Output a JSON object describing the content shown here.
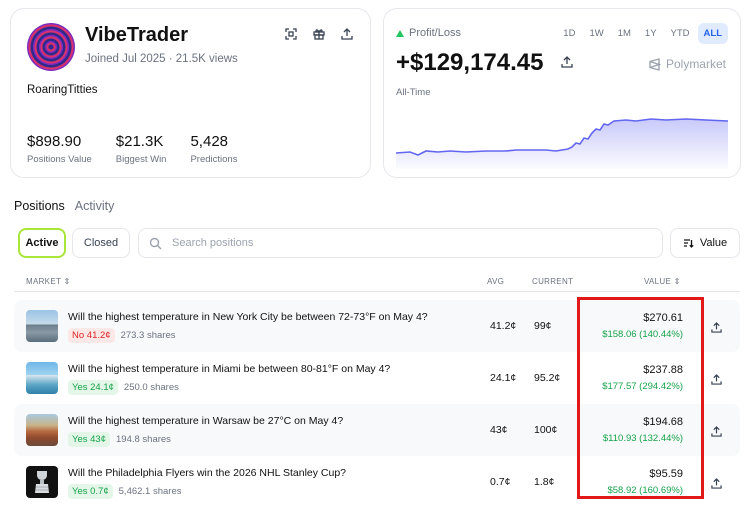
{
  "profile": {
    "username": "VibeTrader",
    "joined": "Joined Jul 2025 · 21.5K views",
    "tagline": "RoaringTitties",
    "stats": [
      {
        "value": "$898.90",
        "label": "Positions Value"
      },
      {
        "value": "$21.3K",
        "label": "Biggest Win"
      },
      {
        "value": "5,428",
        "label": "Predictions"
      }
    ]
  },
  "pnl": {
    "label": "Profit/Loss",
    "amount": "+$129,174.45",
    "range_label": "All-Time",
    "brand": "Polymarket",
    "ranges": [
      "1D",
      "1W",
      "1M",
      "1Y",
      "YTD",
      "ALL"
    ],
    "selected_range": "ALL",
    "line_color": "#6366f1"
  },
  "tabs": {
    "positions": "Positions",
    "activity": "Activity"
  },
  "filters": {
    "active": "Active",
    "closed": "Closed"
  },
  "search": {
    "placeholder": "Search positions"
  },
  "sort": {
    "label": "Value"
  },
  "table": {
    "headers": {
      "market": "MARKET",
      "avg": "AVG",
      "current": "CURRENT",
      "value": "VALUE"
    },
    "rows": [
      {
        "question": "Will the highest temperature in New York City be between 72-73°F on May 4?",
        "side": "No 41.2¢",
        "side_type": "no",
        "shares": "273.3 shares",
        "avg": "41.2¢",
        "current": "99¢",
        "value": "$270.61",
        "change": "$158.06 (140.44%)",
        "thumb": "nyc-skyline"
      },
      {
        "question": "Will the highest temperature in Miami be between 80-81°F on May 4?",
        "side": "Yes 24.1¢",
        "side_type": "yes",
        "shares": "250.0 shares",
        "avg": "24.1¢",
        "current": "95.2¢",
        "value": "$237.88",
        "change": "$177.57 (294.42%)",
        "thumb": "miami-skyline"
      },
      {
        "question": "Will the highest temperature in Warsaw be 27°C on May 4?",
        "side": "Yes 43¢",
        "side_type": "yes",
        "shares": "194.8 shares",
        "avg": "43¢",
        "current": "100¢",
        "value": "$194.68",
        "change": "$110.93 (132.44%)",
        "thumb": "warsaw-oldtown"
      },
      {
        "question": "Will the Philadelphia Flyers win the 2026 NHL Stanley Cup?",
        "side": "Yes 0.7¢",
        "side_type": "yes",
        "shares": "5,462.1 shares",
        "avg": "0.7¢",
        "current": "1.8¢",
        "value": "$95.59",
        "change": "$58.92 (160.69%)",
        "thumb": "stanley-cup"
      }
    ]
  }
}
